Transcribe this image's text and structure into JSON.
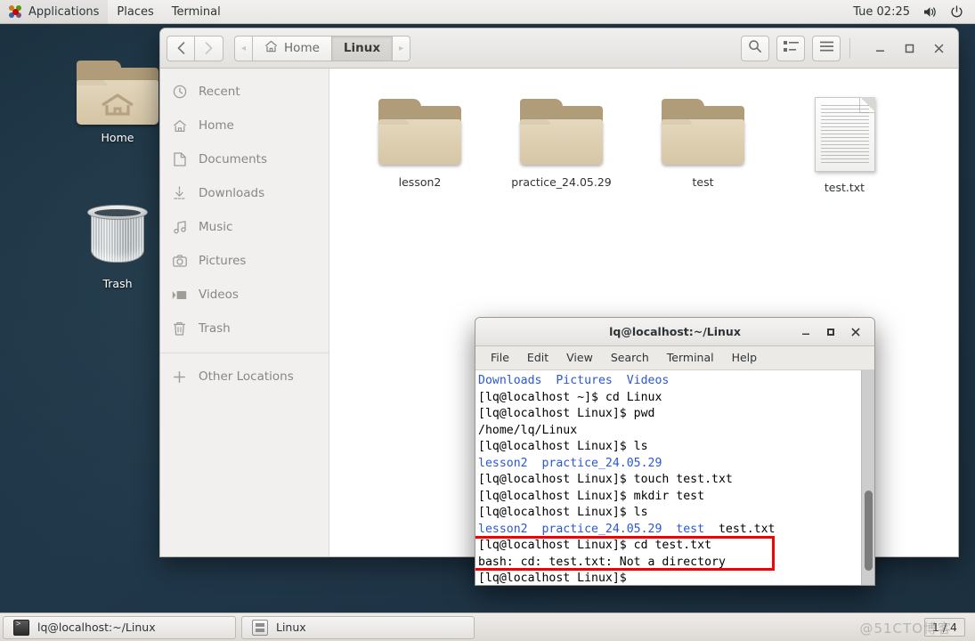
{
  "top_panel": {
    "logo_icon": "gnome-foot-icon",
    "menus": [
      "Applications",
      "Places",
      "Terminal"
    ],
    "clock": "Tue 02:25",
    "volume_icon": "volume-icon",
    "power_icon": "power-icon"
  },
  "desktop": {
    "icons": [
      {
        "label": "Home",
        "icon": "home-folder-icon"
      },
      {
        "label": "Trash",
        "icon": "trash-icon"
      }
    ]
  },
  "file_manager": {
    "nav": {
      "back_icon": "chevron-left-icon",
      "forward_icon": "chevron-right-icon"
    },
    "breadcrumb": {
      "left_arrow": "◂",
      "home_icon": "home-icon",
      "home_label": "Home",
      "current_label": "Linux",
      "right_arrow": "▸"
    },
    "toolbar": {
      "search_icon": "search-icon",
      "view_list_icon": "list-view-icon",
      "menu_icon": "hamburger-menu-icon",
      "minimize_label": "–",
      "maximize_label": "□",
      "close_label": "✕"
    },
    "sidebar": {
      "items": [
        {
          "label": "Recent",
          "icon": "clock-icon"
        },
        {
          "label": "Home",
          "icon": "home-icon"
        },
        {
          "label": "Documents",
          "icon": "document-icon"
        },
        {
          "label": "Downloads",
          "icon": "download-icon"
        },
        {
          "label": "Music",
          "icon": "music-note-icon"
        },
        {
          "label": "Pictures",
          "icon": "camera-icon"
        },
        {
          "label": "Videos",
          "icon": "video-icon"
        },
        {
          "label": "Trash",
          "icon": "trash-icon"
        }
      ],
      "other": {
        "label": "Other Locations",
        "icon": "plus-icon"
      }
    },
    "files": [
      {
        "name": "lesson2",
        "type": "folder"
      },
      {
        "name": "practice_24.05.29",
        "type": "folder"
      },
      {
        "name": "test",
        "type": "folder"
      },
      {
        "name": "test.txt",
        "type": "text-file"
      }
    ]
  },
  "terminal": {
    "title": "lq@localhost:~/Linux",
    "window_buttons": {
      "minimize": "–",
      "maximize": "□",
      "close": "✕"
    },
    "menu": [
      "File",
      "Edit",
      "View",
      "Search",
      "Terminal",
      "Help"
    ],
    "highlight_color": "#f40000",
    "dir_color": "#2a57d6",
    "lines": [
      {
        "segments": [
          {
            "text": "Downloads  Pictures  Videos",
            "color": "blue"
          }
        ]
      },
      {
        "segments": [
          {
            "text": "[lq@localhost ~]$ cd Linux",
            "color": "black"
          }
        ]
      },
      {
        "segments": [
          {
            "text": "[lq@localhost Linux]$ pwd",
            "color": "black"
          }
        ]
      },
      {
        "segments": [
          {
            "text": "/home/lq/Linux",
            "color": "black"
          }
        ]
      },
      {
        "segments": [
          {
            "text": "[lq@localhost Linux]$ ls",
            "color": "black"
          }
        ]
      },
      {
        "segments": [
          {
            "text": "lesson2  practice_24.05.29",
            "color": "blue"
          }
        ]
      },
      {
        "segments": [
          {
            "text": "[lq@localhost Linux]$ touch test.txt",
            "color": "black"
          }
        ]
      },
      {
        "segments": [
          {
            "text": "[lq@localhost Linux]$ mkdir test",
            "color": "black"
          }
        ]
      },
      {
        "segments": [
          {
            "text": "[lq@localhost Linux]$ ls",
            "color": "black"
          }
        ]
      },
      {
        "segments": [
          {
            "text": "lesson2  practice_24.05.29  test",
            "color": "blue"
          },
          {
            "text": "  test.txt",
            "color": "black"
          }
        ]
      },
      {
        "segments": [
          {
            "text": "[lq@localhost Linux]$ cd test.txt",
            "color": "black"
          }
        ]
      },
      {
        "segments": [
          {
            "text": "bash: cd: test.txt: Not a directory",
            "color": "black"
          }
        ]
      },
      {
        "segments": [
          {
            "text": "[lq@localhost Linux]$",
            "color": "black"
          }
        ]
      }
    ]
  },
  "taskbar": {
    "tasks": [
      {
        "label": "lq@localhost:~/Linux",
        "icon": "terminal-icon"
      },
      {
        "label": "Linux",
        "icon": "file-manager-icon"
      }
    ],
    "workspace": "1 / 4",
    "watermark": "@51CTO博客"
  }
}
